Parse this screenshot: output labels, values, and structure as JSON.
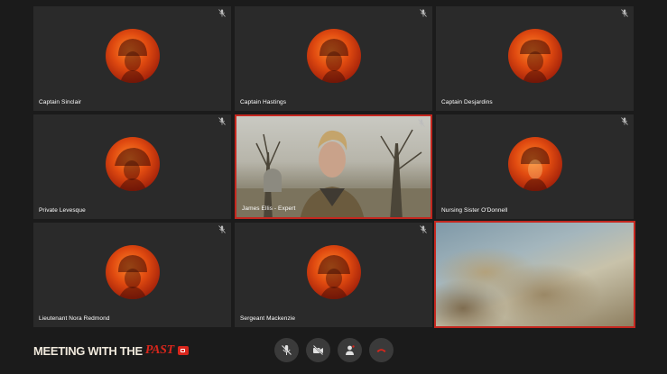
{
  "participants": [
    {
      "name": "Captain Sinclair",
      "muted": true
    },
    {
      "name": "Captain Hastings",
      "muted": true
    },
    {
      "name": "Captain Desjardins",
      "muted": true
    },
    {
      "name": "Private Levesque",
      "muted": true
    },
    {
      "name": "James Ellis - Expert",
      "muted": true,
      "video": true,
      "active": true
    },
    {
      "name": "Nursing Sister O'Donnell",
      "muted": true
    },
    {
      "name": "Lieutenant Nora Redmond",
      "muted": true
    },
    {
      "name": "Sergeant Mackenzie",
      "muted": true
    },
    {
      "name": "",
      "muted": false,
      "video": true,
      "active": true
    }
  ],
  "logo": {
    "text_main": "MEETING WITH THE",
    "text_accent": "PAST"
  },
  "controls": [
    {
      "id": "mute",
      "icon": "mic-off-icon"
    },
    {
      "id": "camera",
      "icon": "camera-off-icon"
    },
    {
      "id": "participants",
      "icon": "person-icon"
    },
    {
      "id": "hangup",
      "icon": "phone-hangup-icon"
    }
  ],
  "colors": {
    "accent": "#d8261c",
    "tile": "#2a2a2a",
    "background": "#1b1b1b"
  }
}
